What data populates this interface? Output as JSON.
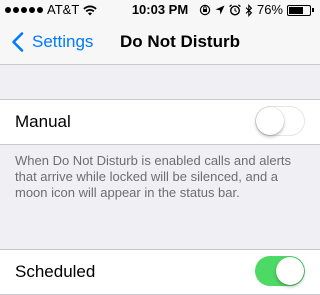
{
  "status_bar": {
    "signal_bars": 5,
    "carrier": "AT&T",
    "time": "10:03 PM",
    "battery": "76%",
    "battery_level": 0.76,
    "icons": [
      "wifi-icon",
      "orientation-lock-icon",
      "location-icon",
      "alarm-icon",
      "bluetooth-icon",
      "battery-icon"
    ]
  },
  "nav": {
    "back_label": "Settings",
    "title": "Do Not Disturb"
  },
  "manual": {
    "label": "Manual",
    "enabled": false,
    "footer": "When Do Not Disturb is enabled calls and alerts that arrive while locked will be silenced, and a moon icon will appear in the status bar."
  },
  "scheduled": {
    "label": "Scheduled",
    "enabled": true
  },
  "colors": {
    "tint": "#007aff",
    "switch_on": "#4cd964",
    "background": "#efeff4"
  }
}
